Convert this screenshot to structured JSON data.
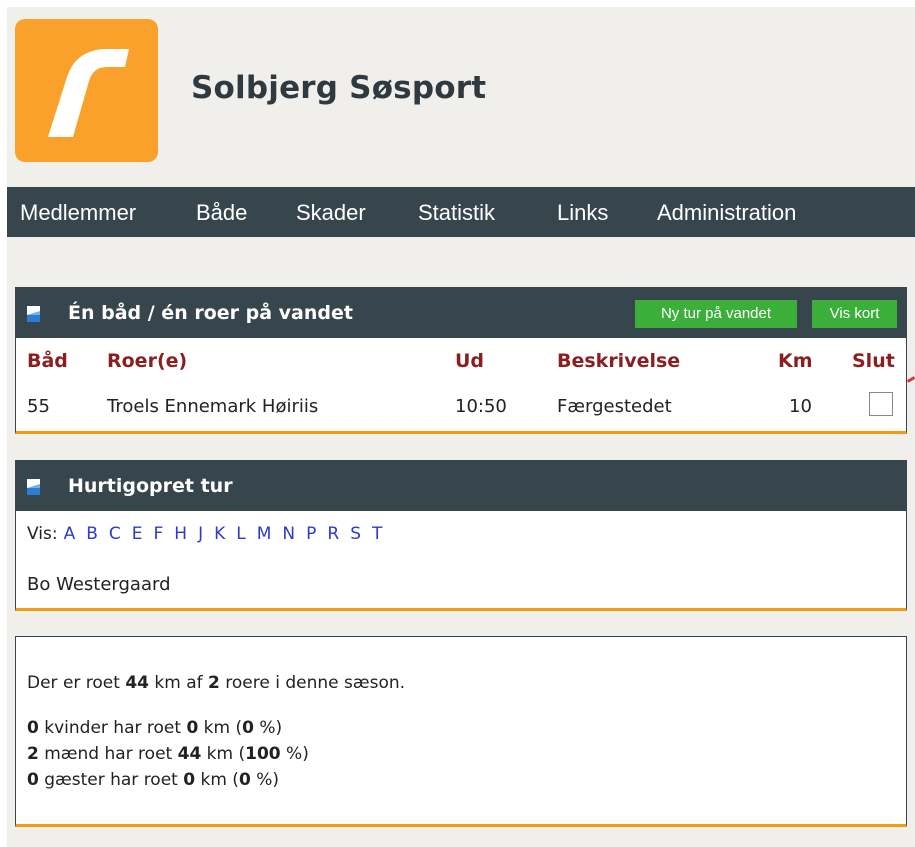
{
  "site": {
    "title": "Solbjerg Søsport"
  },
  "nav": {
    "items": [
      "Medlemmer",
      "Både",
      "Skader",
      "Statistik",
      "Links",
      "Administration"
    ]
  },
  "on_water": {
    "title": "Én båd / én roer på vandet",
    "buttons": {
      "new_trip": "Ny tur på vandet",
      "show_map": "Vis kort"
    },
    "columns": [
      "Båd",
      "Roer(e)",
      "Ud",
      "Beskrivelse",
      "Km",
      "Slut"
    ],
    "rows": [
      {
        "boat": "55",
        "rowers": "Troels Ennemark Høiriis",
        "out": "10:50",
        "description": "Færgestedet",
        "km": "10",
        "done": false
      }
    ]
  },
  "quick_trip": {
    "title": "Hurtigopret tur",
    "filter_label": "Vis:",
    "letters": [
      "A",
      "B",
      "C",
      "E",
      "F",
      "H",
      "J",
      "K",
      "L",
      "M",
      "N",
      "P",
      "R",
      "S",
      "T"
    ],
    "member": "Bo Westergaard"
  },
  "stats": {
    "season": {
      "p1": "Der er roet ",
      "km": "44",
      "p2": " km af ",
      "rowers": "2",
      "p3": " roere i denne sæson."
    },
    "women": {
      "count": "0",
      "p1": " kvinder har roet ",
      "km": "0",
      "p2": " km (",
      "pct": "0",
      "p3": " %)"
    },
    "men": {
      "count": "2",
      "p1": " mænd har roet ",
      "km": "44",
      "p2": " km (",
      "pct": "100",
      "p3": " %)"
    },
    "guests": {
      "count": "0",
      "p1": " gæster har roet ",
      "km": "0",
      "p2": " km (",
      "pct": "0",
      "p3": " %)"
    }
  },
  "colors": {
    "logo": "#f9a12b",
    "navbar": "#37464c",
    "panel_accent": "#f39c12",
    "header_text": "#8b1f1f",
    "button": "#3cae3a",
    "link": "#2b3bcc"
  }
}
